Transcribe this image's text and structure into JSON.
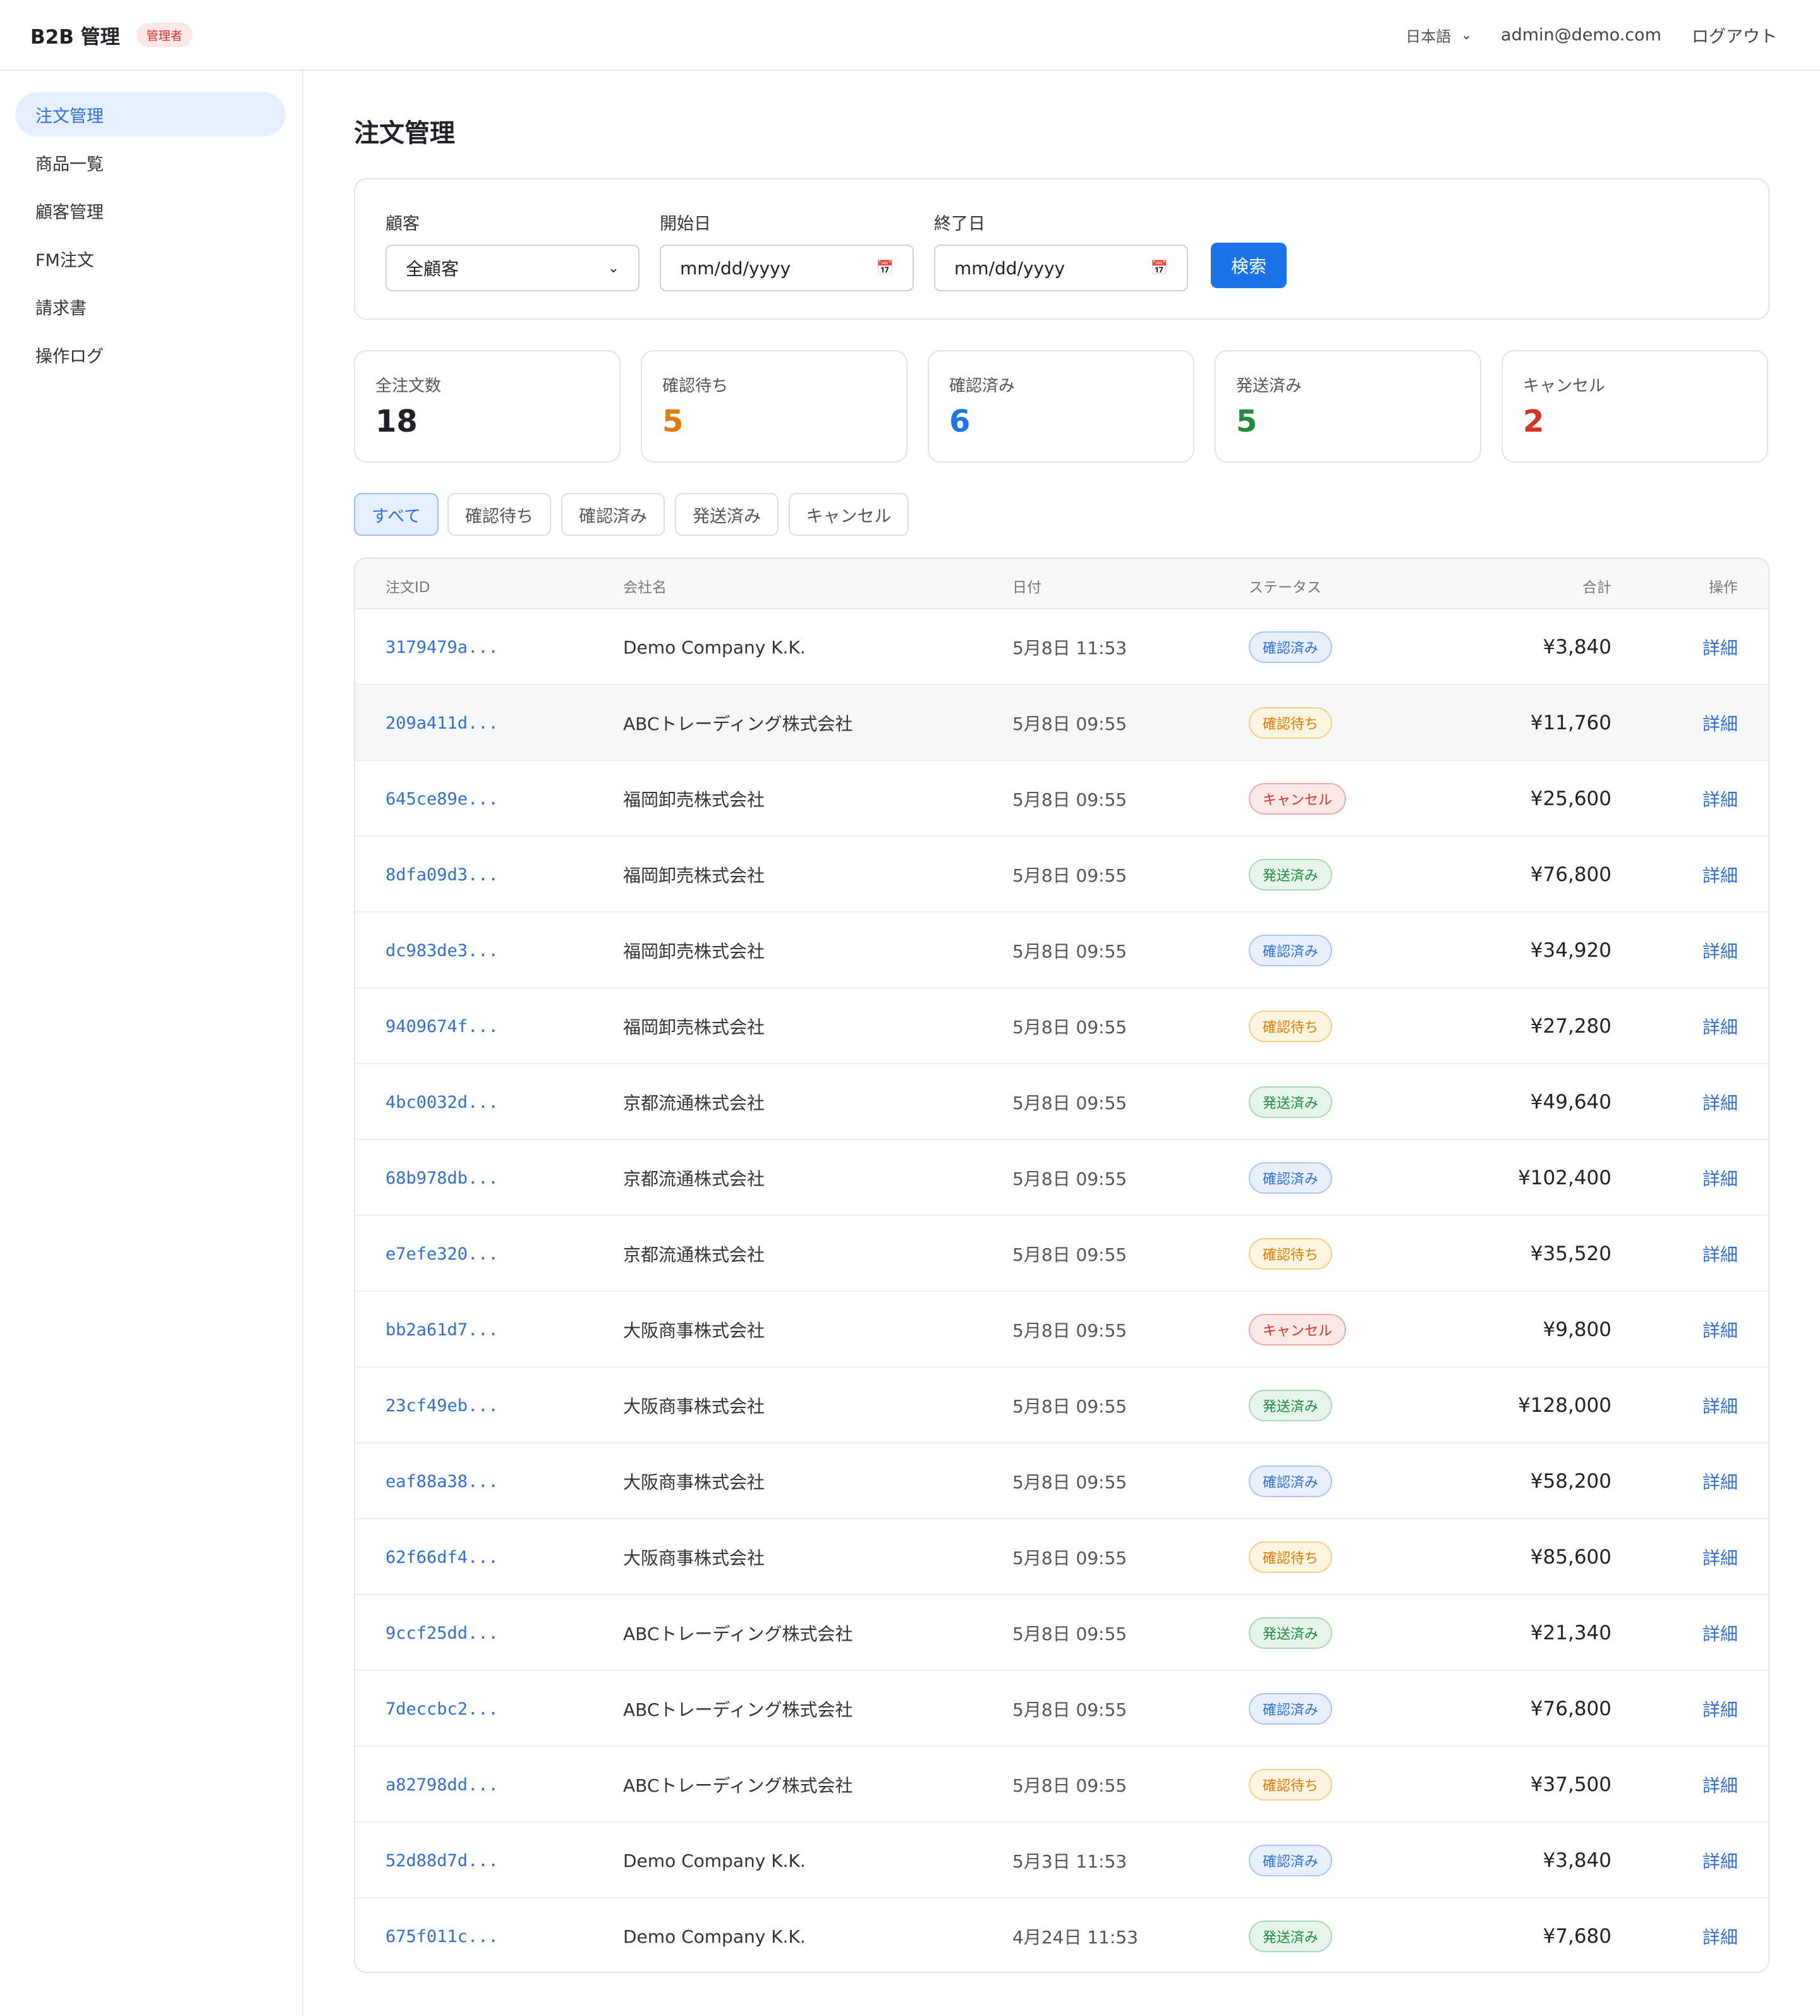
{
  "header": {
    "brand": "B2B 管理",
    "role_badge": "管理者",
    "language": "日本語",
    "user_email": "admin@demo.com",
    "logout_label": "ログアウト"
  },
  "sidebar": {
    "items": [
      {
        "label": "注文管理",
        "active": true
      },
      {
        "label": "商品一覧",
        "active": false
      },
      {
        "label": "顧客管理",
        "active": false
      },
      {
        "label": "FM注文",
        "active": false
      },
      {
        "label": "請求書",
        "active": false
      },
      {
        "label": "操作ログ",
        "active": false
      }
    ]
  },
  "page": {
    "title": "注文管理"
  },
  "filters": {
    "customer_label": "顧客",
    "customer_value": "全顧客",
    "start_label": "開始日",
    "start_value": "mm/dd/yyyy",
    "end_label": "終了日",
    "end_value": "mm/dd/yyyy",
    "search_label": "検索"
  },
  "stats": [
    {
      "label": "全注文数",
      "value": "18",
      "color": "#1f2329"
    },
    {
      "label": "確認待ち",
      "value": "5",
      "color": "#e67700"
    },
    {
      "label": "確認済み",
      "value": "6",
      "color": "#1a73e8"
    },
    {
      "label": "発送済み",
      "value": "5",
      "color": "#1e8e3e"
    },
    {
      "label": "キャンセル",
      "value": "2",
      "color": "#d93026"
    }
  ],
  "status_tabs": [
    "すべて",
    "確認待ち",
    "確認済み",
    "発送済み",
    "キャンセル"
  ],
  "table": {
    "columns": {
      "id": "注文ID",
      "company": "会社名",
      "date": "日付",
      "status": "ステータス",
      "total": "合計",
      "action": "操作"
    },
    "action_label": "詳細",
    "rows": [
      {
        "id": "3179479a...",
        "company": "Demo Company K.K.",
        "date": "5月8日 11:53",
        "status": "確認済み",
        "status_kind": "ok",
        "total": "¥3,840"
      },
      {
        "id": "209a411d...",
        "company": "ABCトレーディング株式会社",
        "date": "5月8日 09:55",
        "status": "確認待ち",
        "status_kind": "wait",
        "total": "¥11,760"
      },
      {
        "id": "645ce89e...",
        "company": "福岡卸売株式会社",
        "date": "5月8日 09:55",
        "status": "キャンセル",
        "status_kind": "cancel",
        "total": "¥25,600"
      },
      {
        "id": "8dfa09d3...",
        "company": "福岡卸売株式会社",
        "date": "5月8日 09:55",
        "status": "発送済み",
        "status_kind": "ship",
        "total": "¥76,800"
      },
      {
        "id": "dc983de3...",
        "company": "福岡卸売株式会社",
        "date": "5月8日 09:55",
        "status": "確認済み",
        "status_kind": "ok",
        "total": "¥34,920"
      },
      {
        "id": "9409674f...",
        "company": "福岡卸売株式会社",
        "date": "5月8日 09:55",
        "status": "確認待ち",
        "status_kind": "wait",
        "total": "¥27,280"
      },
      {
        "id": "4bc0032d...",
        "company": "京都流通株式会社",
        "date": "5月8日 09:55",
        "status": "発送済み",
        "status_kind": "ship",
        "total": "¥49,640"
      },
      {
        "id": "68b978db...",
        "company": "京都流通株式会社",
        "date": "5月8日 09:55",
        "status": "確認済み",
        "status_kind": "ok",
        "total": "¥102,400"
      },
      {
        "id": "e7efe320...",
        "company": "京都流通株式会社",
        "date": "5月8日 09:55",
        "status": "確認待ち",
        "status_kind": "wait",
        "total": "¥35,520"
      },
      {
        "id": "bb2a61d7...",
        "company": "大阪商事株式会社",
        "date": "5月8日 09:55",
        "status": "キャンセル",
        "status_kind": "cancel",
        "total": "¥9,800"
      },
      {
        "id": "23cf49eb...",
        "company": "大阪商事株式会社",
        "date": "5月8日 09:55",
        "status": "発送済み",
        "status_kind": "ship",
        "total": "¥128,000"
      },
      {
        "id": "eaf88a38...",
        "company": "大阪商事株式会社",
        "date": "5月8日 09:55",
        "status": "確認済み",
        "status_kind": "ok",
        "total": "¥58,200"
      },
      {
        "id": "62f66df4...",
        "company": "大阪商事株式会社",
        "date": "5月8日 09:55",
        "status": "確認待ち",
        "status_kind": "wait",
        "total": "¥85,600"
      },
      {
        "id": "9ccf25dd...",
        "company": "ABCトレーディング株式会社",
        "date": "5月8日 09:55",
        "status": "発送済み",
        "status_kind": "ship",
        "total": "¥21,340"
      },
      {
        "id": "7deccbc2...",
        "company": "ABCトレーディング株式会社",
        "date": "5月8日 09:55",
        "status": "確認済み",
        "status_kind": "ok",
        "total": "¥76,800"
      },
      {
        "id": "a82798dd...",
        "company": "ABCトレーディング株式会社",
        "date": "5月8日 09:55",
        "status": "確認待ち",
        "status_kind": "wait",
        "total": "¥37,500"
      },
      {
        "id": "52d88d7d...",
        "company": "Demo Company K.K.",
        "date": "5月3日 11:53",
        "status": "確認済み",
        "status_kind": "ok",
        "total": "¥3,840"
      },
      {
        "id": "675f011c...",
        "company": "Demo Company K.K.",
        "date": "4月24日 11:53",
        "status": "発送済み",
        "status_kind": "ship",
        "total": "¥7,680"
      }
    ]
  }
}
